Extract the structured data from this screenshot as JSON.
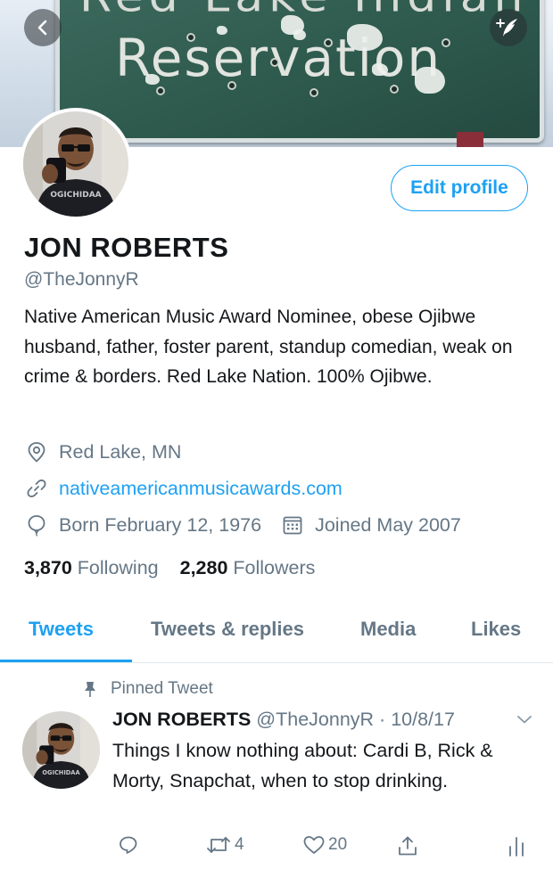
{
  "banner": {
    "sign_top_text": "Red Lake Indian",
    "sign_main_text": "Reservation",
    "back_icon": "chevron-left-icon",
    "compose_icon": "compose-tweet-icon"
  },
  "profile": {
    "edit_button": "Edit profile",
    "display_name": "JON ROBERTS",
    "handle": "@TheJonnyR",
    "bio": "Native American Music Award Nominee, obese Ojibwe husband, father, foster parent, standup comedian, weak on crime & borders. Red Lake Nation. 100% Ojibwe.",
    "location": "Red Lake, MN",
    "website": "nativeamericanmusicawards.com",
    "born": "Born February 12, 1976",
    "joined": "Joined May 2007",
    "following_count": "3,870",
    "following_label": "Following",
    "followers_count": "2,280",
    "followers_label": "Followers",
    "avatar_shirt_text": "OGICHIDAA"
  },
  "tabs": [
    {
      "label": "Tweets",
      "active": true
    },
    {
      "label": "Tweets & replies",
      "active": false
    },
    {
      "label": "Media",
      "active": false
    },
    {
      "label": "Likes",
      "active": false
    }
  ],
  "pinned_tweet": {
    "pinned_label": "Pinned Tweet",
    "author_name": "JON ROBERTS",
    "author_handle": "@TheJonnyR",
    "separator": " · ",
    "date": "10/8/17",
    "text": "Things I know nothing about: Cardi B, Rick & Morty, Snapchat, when to stop drinking.",
    "reply_count": "",
    "retweet_count": "4",
    "like_count": "20"
  },
  "colors": {
    "accent": "#1da1f2",
    "secondary_text": "#657786",
    "primary_text": "#14171a",
    "divider": "#e1e8ed"
  }
}
